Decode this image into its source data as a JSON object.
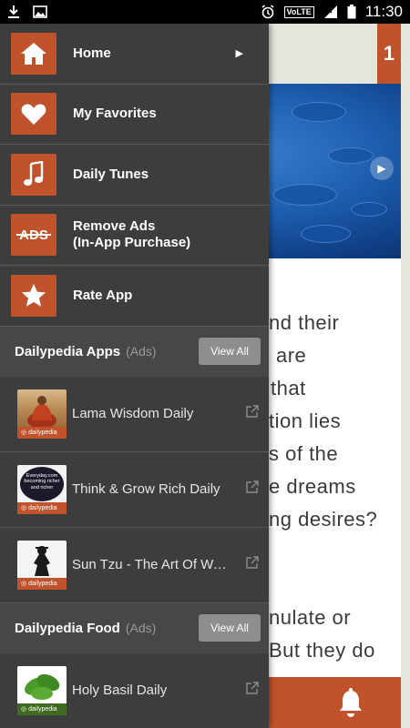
{
  "status_bar": {
    "network": "VoLTE",
    "time": "11:30"
  },
  "background": {
    "counter": "1",
    "article_lines": [
      "nd their",
      "are",
      "that",
      "tion lies",
      "s of the",
      "e dreams",
      "ng desires?",
      "nulate or",
      "But they do"
    ]
  },
  "drawer": {
    "menu": [
      {
        "label": "Home",
        "icon": "home-icon",
        "has_submenu": true
      },
      {
        "label": "My Favorites",
        "icon": "heart-icon",
        "has_submenu": false
      },
      {
        "label": "Daily Tunes",
        "icon": "music-note-icon",
        "has_submenu": false
      },
      {
        "label": "Remove Ads",
        "label2": "(In-App Purchase)",
        "icon": "no-ads-icon",
        "icon_text": "ADS",
        "has_submenu": false
      },
      {
        "label": "Rate App",
        "icon": "star-icon",
        "has_submenu": false
      }
    ],
    "apps_section": {
      "title": "Dailypedia Apps",
      "ads_tag": "(Ads)",
      "view_all": "View All",
      "items": [
        {
          "name": "Lama Wisdom Daily",
          "brand": "dailypedia"
        },
        {
          "name": "Think & Grow Rich Daily",
          "brand": "dailypedia",
          "thumb_text1": "Everyday.com",
          "thumb_text2": "becoming richer",
          "thumb_text3": "and richer"
        },
        {
          "name": "Sun Tzu - The Art Of War Daily",
          "brand": "dailypedia"
        }
      ]
    },
    "food_section": {
      "title": "Dailypedia Food",
      "ads_tag": "(Ads)",
      "view_all": "View All",
      "items": [
        {
          "name": "Holy Basil Daily",
          "brand": "dailypedia"
        }
      ]
    }
  },
  "colors": {
    "accent": "#c0532b",
    "drawer_bg": "#3d3d3d",
    "section_bg": "#474747"
  }
}
